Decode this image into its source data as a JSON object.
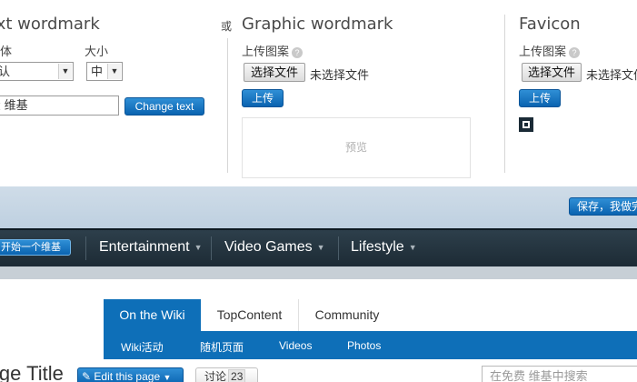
{
  "editor": {
    "text_wordmark": {
      "title": "Text wordmark",
      "font_label": "字体",
      "size_label": "大小",
      "font_value": "默认",
      "size_value": "中",
      "text_value": "免费 维基",
      "change_button": "Change text"
    },
    "or_label": "或",
    "graphic_wordmark": {
      "title": "Graphic wordmark",
      "upload_label": "上传图案",
      "choose_file": "选择文件",
      "no_file": "未选择文件",
      "upload_button": "上传",
      "preview": "预览"
    },
    "favicon": {
      "title": "Favicon",
      "upload_label": "上传图案",
      "choose_file": "选择文件",
      "no_file": "未选择文件",
      "upload_button": "上传"
    }
  },
  "save_button": "保存，我做完了",
  "globalnav": {
    "start_wiki": "开始一个维基",
    "items": [
      {
        "label": "Entertainment"
      },
      {
        "label": "Video Games"
      },
      {
        "label": "Lifestyle"
      }
    ]
  },
  "wikinav": {
    "tabs": [
      {
        "label": "On the Wiki"
      },
      {
        "label": "TopContent"
      },
      {
        "label": "Community"
      }
    ],
    "subitems": [
      {
        "label": "Wiki活动"
      },
      {
        "label": "随机页面"
      },
      {
        "label": "Videos"
      },
      {
        "label": "Photos"
      }
    ]
  },
  "page": {
    "title": "Page Title",
    "edit_button": "Edit this page",
    "talk_label": "讨论",
    "talk_count": "23",
    "search_placeholder": "在免费 维基中搜索"
  }
}
